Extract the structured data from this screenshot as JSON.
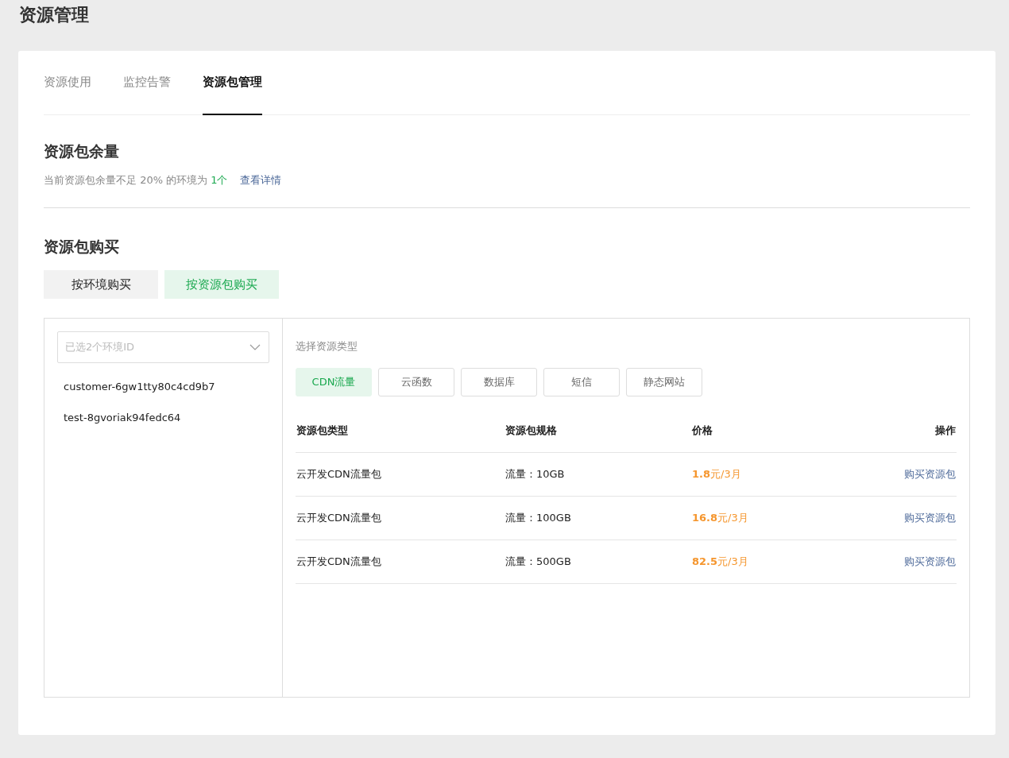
{
  "page_title": "资源管理",
  "tabs": [
    {
      "label": "资源使用",
      "selected": false
    },
    {
      "label": "监控告警",
      "selected": false
    },
    {
      "label": "资源包管理",
      "selected": true
    }
  ],
  "balance": {
    "title": "资源包余量",
    "note": "当前资源包余量不足 20% 的环境为",
    "count": "1个",
    "link": "查看详情"
  },
  "purchase": {
    "title": "资源包购买",
    "modes": [
      {
        "label": "按环境购买",
        "selected": false
      },
      {
        "label": "按资源包购买",
        "selected": true
      }
    ],
    "env_select": {
      "placeholder": "已选2个环境ID"
    },
    "envs": [
      "customer-6gw1tty80c4cd9b7",
      "test-8gvoriak94fedc64"
    ],
    "type_label": "选择资源类型",
    "types": [
      {
        "label": "CDN流量",
        "selected": true
      },
      {
        "label": "云函数",
        "selected": false
      },
      {
        "label": "数据库",
        "selected": false
      },
      {
        "label": "短信",
        "selected": false
      },
      {
        "label": "静态网站",
        "selected": false
      }
    ],
    "table": {
      "columns": [
        "资源包类型",
        "资源包规格",
        "价格",
        "操作"
      ],
      "rows": [
        {
          "type": "云开发CDN流量包",
          "spec": "流量：10GB",
          "price": "**1.8**元/3月",
          "action": "购买资源包"
        },
        {
          "type": "云开发CDN流量包",
          "spec": "流量：100GB",
          "price": "**16.8**元/3月",
          "action": "购买资源包"
        },
        {
          "type": "云开发CDN流量包",
          "spec": "流量：500GB",
          "price": "**82.5**元/3月",
          "action": "购买资源包"
        }
      ]
    }
  }
}
